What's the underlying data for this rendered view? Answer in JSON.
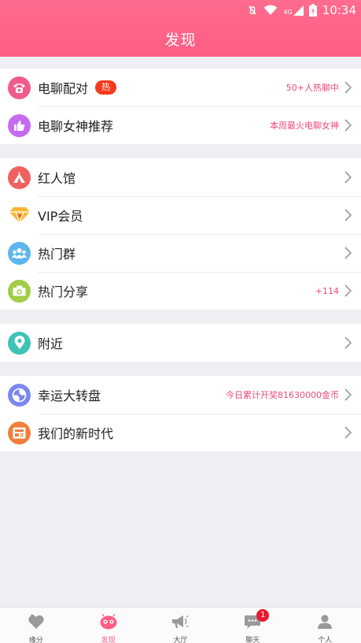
{
  "status": {
    "time": "10:34",
    "network": "4G"
  },
  "header": {
    "title": "发现"
  },
  "groups": [
    {
      "items": [
        {
          "label": "电聊配对",
          "badge": "热",
          "right": "50+人热聊中",
          "icon": "phone-icon",
          "color": "#f05b8c"
        },
        {
          "label": "电聊女神推荐",
          "right": "本周最火电聊女神",
          "icon": "thumbs-up-icon",
          "color": "#c56cf0"
        }
      ]
    },
    {
      "items": [
        {
          "label": "红人馆",
          "icon": "tent-icon",
          "color": "#f0605e"
        },
        {
          "label": "VIP会员",
          "icon": "diamond-icon",
          "color": "#f7b733"
        },
        {
          "label": "热门群",
          "icon": "group-icon",
          "color": "#5db6ee"
        },
        {
          "label": "热门分享",
          "right": "+114",
          "icon": "camera-icon",
          "color": "#a2cd48"
        }
      ]
    },
    {
      "items": [
        {
          "label": "附近",
          "icon": "location-pin-icon",
          "color": "#3ec2b6"
        }
      ]
    },
    {
      "items": [
        {
          "label": "幸运大转盘",
          "right": "今日累计开奖81630000金币",
          "icon": "wheel-icon",
          "color": "#7a87ee"
        },
        {
          "label": "我们的新时代",
          "icon": "news-icon",
          "color": "#f07f3a"
        }
      ]
    }
  ],
  "tabs": [
    {
      "label": "缘分",
      "icon": "heart-icon"
    },
    {
      "label": "发现",
      "icon": "discover-icon",
      "active": true
    },
    {
      "label": "大厅",
      "icon": "megaphone-icon"
    },
    {
      "label": "聊天",
      "icon": "chat-icon",
      "badge": "1"
    },
    {
      "label": "个人",
      "icon": "person-icon"
    }
  ]
}
